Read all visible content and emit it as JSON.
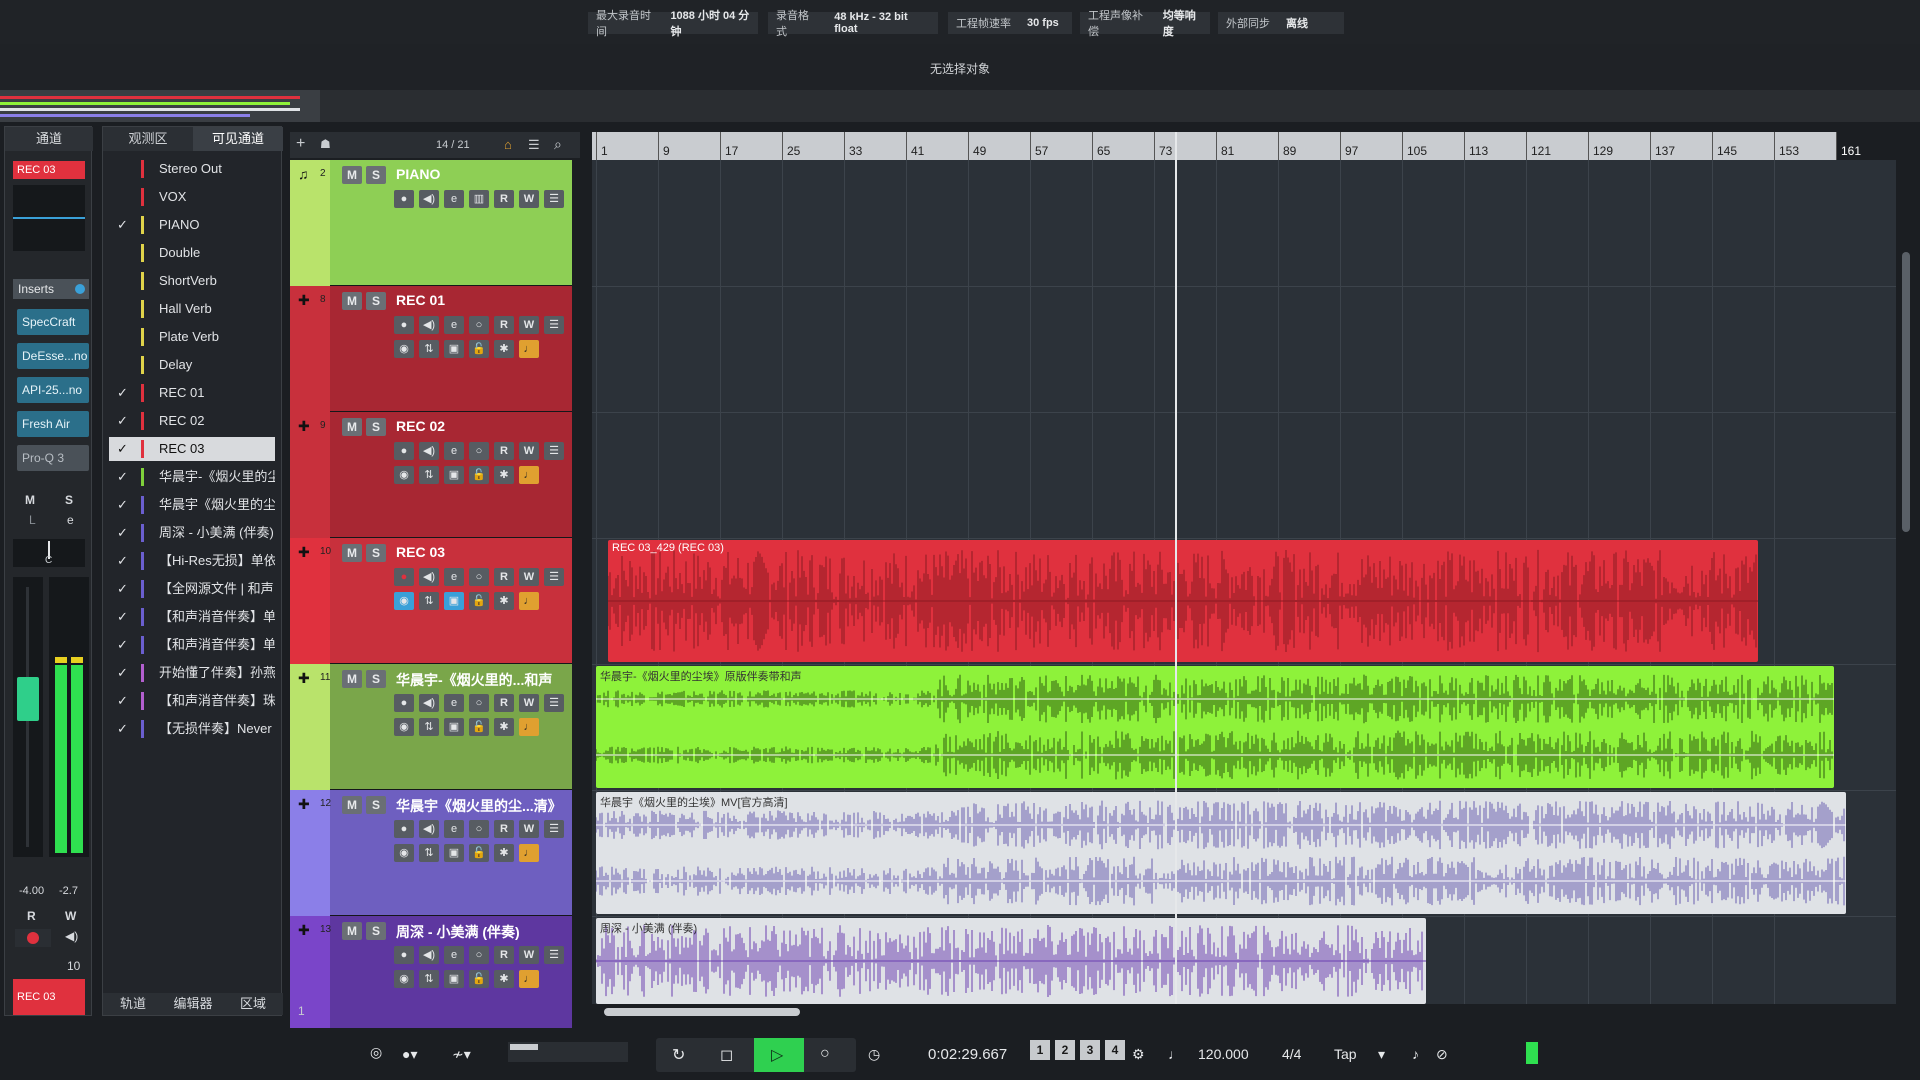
{
  "topbar": {
    "groups": [
      {
        "label": "最大录音时间",
        "value": "1088 小时 04 分钟"
      },
      {
        "label": "录音格式",
        "value": "48 kHz - 32 bit float"
      },
      {
        "label": "工程帧速率",
        "value": "30 fps"
      },
      {
        "label": "工程声像补偿",
        "value": "均等响度"
      },
      {
        "label": "外部同步",
        "value": "离线"
      }
    ]
  },
  "infoline": {
    "text": "无选择对象"
  },
  "inspector": {
    "tabs": [
      "通道"
    ],
    "track_name": "REC 03",
    "inserts_label": "Inserts",
    "plugins": [
      "SpecCraft",
      "DeEsse...no",
      "API-25...no",
      "Fresh Air",
      "Pro-Q 3"
    ],
    "m": "M",
    "s": "S",
    "l": "L",
    "e": "e",
    "pan": "C",
    "vol_a": "-4.00",
    "vol_b": "-2.7",
    "r": "R",
    "w": "W",
    "send_val": "10",
    "footer_name": "REC 03"
  },
  "vispanel": {
    "tabs": [
      "观测区",
      "可见通道"
    ],
    "items": [
      {
        "check": "",
        "label": "Stereo Out",
        "color": "#e0313e"
      },
      {
        "check": "",
        "label": "VOX",
        "color": "#e0313e"
      },
      {
        "check": "✓",
        "label": "PIANO",
        "color": "#e0d34a"
      },
      {
        "check": "",
        "label": "Double",
        "color": "#e0d34a"
      },
      {
        "check": "",
        "label": "ShortVerb",
        "color": "#e0d34a"
      },
      {
        "check": "",
        "label": "Hall Verb",
        "color": "#e0d34a"
      },
      {
        "check": "",
        "label": "Plate Verb",
        "color": "#e0d34a"
      },
      {
        "check": "",
        "label": "Delay",
        "color": "#e0d34a"
      },
      {
        "check": "✓",
        "label": "REC 01",
        "color": "#e0313e"
      },
      {
        "check": "✓",
        "label": "REC 02",
        "color": "#e0313e"
      },
      {
        "check": "✓",
        "label": "REC 03",
        "color": "#e0313e"
      },
      {
        "check": "✓",
        "label": "华晨宇-《烟火里的尘",
        "color": "#7fd13b"
      },
      {
        "check": "✓",
        "label": "华晨宇《烟火里的尘",
        "color": "#6b5fcf"
      },
      {
        "check": "✓",
        "label": "周深 - 小美满 (伴奏)",
        "color": "#6b5fcf"
      },
      {
        "check": "✓",
        "label": "【Hi-Res无损】单依纯",
        "color": "#6b5fcf"
      },
      {
        "check": "✓",
        "label": "【全网源文件 | 和声",
        "color": "#6b5fcf"
      },
      {
        "check": "✓",
        "label": "【和声消音伴奏】单依",
        "color": "#6b5fcf"
      },
      {
        "check": "✓",
        "label": "【和声消音伴奏】单依",
        "color": "#6b5fcf"
      },
      {
        "check": "✓",
        "label": "开始懂了伴奏】孙燕",
        "color": "#b35fcf"
      },
      {
        "check": "✓",
        "label": "【和声消音伴奏】珠玉",
        "color": "#b35fcf"
      },
      {
        "check": "✓",
        "label": "【无损伴奏】Never er",
        "color": "#6b5fcf"
      }
    ],
    "bottom_tabs": [
      "轨道",
      "编辑器",
      "区域"
    ]
  },
  "toolbar": {
    "counter": "14 / 21",
    "footer_num": "1"
  },
  "tracks": [
    {
      "num": "2",
      "name": "PIANO",
      "color": "#b9e36b",
      "panel": "#8ecf55"
    },
    {
      "num": "8",
      "name": "REC 01",
      "color": "#c8303c",
      "panel": "#a82733"
    },
    {
      "num": "9",
      "name": "REC 02",
      "color": "#c8303c",
      "panel": "#a82733"
    },
    {
      "num": "10",
      "name": "REC 03",
      "color": "#e0313e",
      "panel": "#c8303c"
    },
    {
      "num": "11",
      "name": "华晨宇-《烟火里的...和声",
      "color": "#b9e36b",
      "panel": "#7aa64a"
    },
    {
      "num": "12",
      "name": "华晨宇《烟火里的尘...清》",
      "color": "#8b7fe8",
      "panel": "#6e5fc0"
    },
    {
      "num": "13",
      "name": "周深 - 小美满 (伴奏)",
      "color": "#7a45c9",
      "panel": "#5e37a0"
    }
  ],
  "track_buttons": {
    "m": "M",
    "s": "S",
    "r": "R",
    "w": "W"
  },
  "ruler": {
    "bars": [
      "1",
      "9",
      "17",
      "25",
      "33",
      "41",
      "49",
      "57",
      "65",
      "73",
      "81",
      "89",
      "97",
      "105",
      "113",
      "121",
      "129",
      "137",
      "145",
      "153",
      "161"
    ]
  },
  "clips": [
    {
      "name": "REC 03_429 (REC 03)",
      "color": "#e0313e",
      "wave": "#8a1a22"
    },
    {
      "name": "华晨宇-《烟火里的尘埃》原版伴奏带和声",
      "color": "#8ef23a",
      "wave": "#2f5a10"
    },
    {
      "name": "华晨宇《烟火里的尘埃》MV[官方高清]",
      "color": "#dfe2e6",
      "wave": "#6a5fb0"
    },
    {
      "name": "周深 - 小美满 (伴奏)",
      "color": "#dfe2e6",
      "wave": "#6b3fb0"
    }
  ],
  "transport": {
    "time": "0:02:29.667",
    "tempo": "120.000",
    "signature": "4/4",
    "tap": "Tap",
    "markers": [
      "1",
      "2",
      "3",
      "4"
    ]
  },
  "colors": {
    "accent": "#e0313e",
    "play": "#2fd050"
  }
}
